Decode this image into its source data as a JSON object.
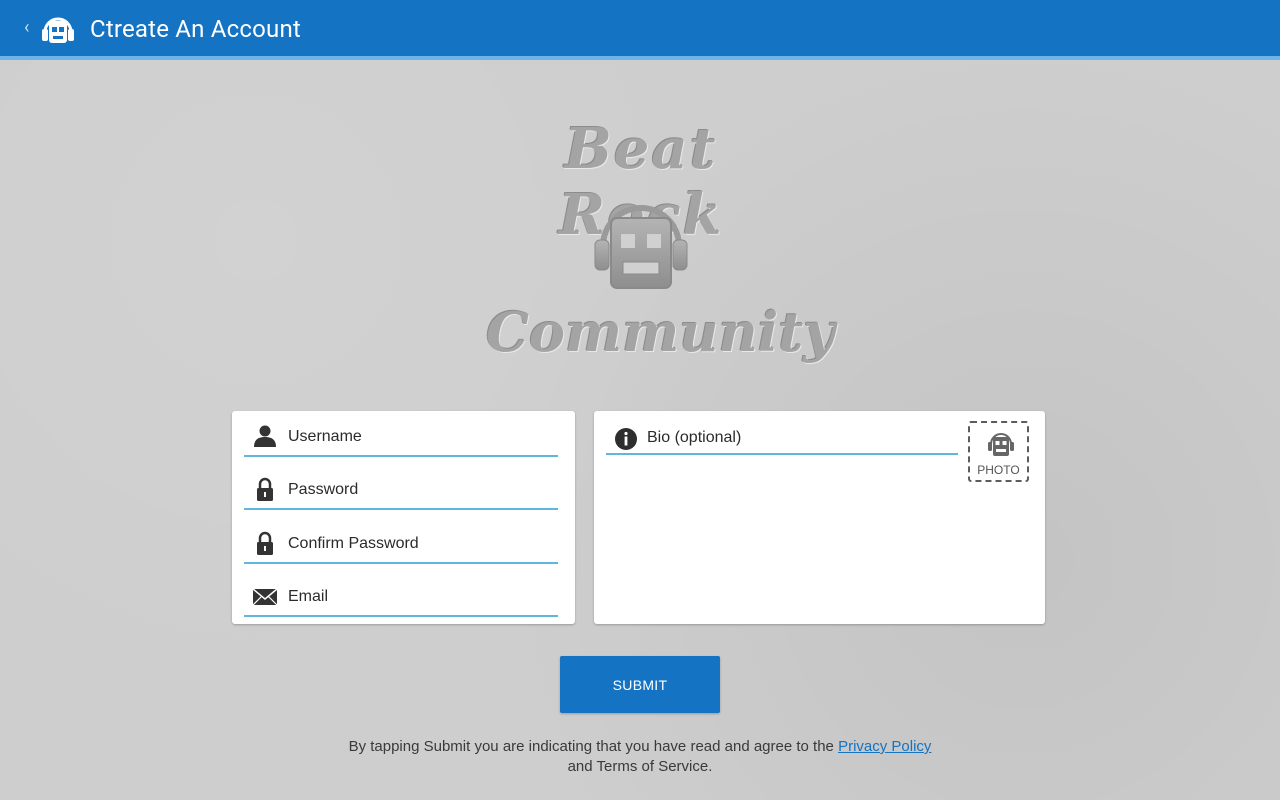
{
  "actionbar": {
    "title": "Ctreate An Account",
    "up_icon": "chevron-left-icon",
    "app_icon": "robot-headphones-icon",
    "color": "#1473c2",
    "accent": "#6fb3e8"
  },
  "logo": {
    "top_text": "Beat Rock",
    "bottom_text": "Community",
    "icon": "robot-headphones-icon"
  },
  "form": {
    "username": {
      "placeholder": "Username",
      "icon": "person-icon"
    },
    "password": {
      "placeholder": "Password",
      "icon": "lock-icon"
    },
    "confirm_password": {
      "placeholder": "Confirm Password",
      "icon": "lock-icon"
    },
    "email": {
      "placeholder": "Email",
      "icon": "envelope-icon"
    },
    "bio": {
      "placeholder": "Bio (optional)",
      "icon": "info-icon"
    },
    "photo": {
      "label": "PHOTO",
      "icon": "robot-headphones-icon"
    },
    "field_underline_color": "#5fb8dc"
  },
  "submit": {
    "label": "SUBMIT"
  },
  "legal": {
    "text_before": "By tapping Submit you are indicating that you have read and agree to the ",
    "privacy_link": "Privacy Policy",
    "text_after": " and Terms of Service."
  }
}
